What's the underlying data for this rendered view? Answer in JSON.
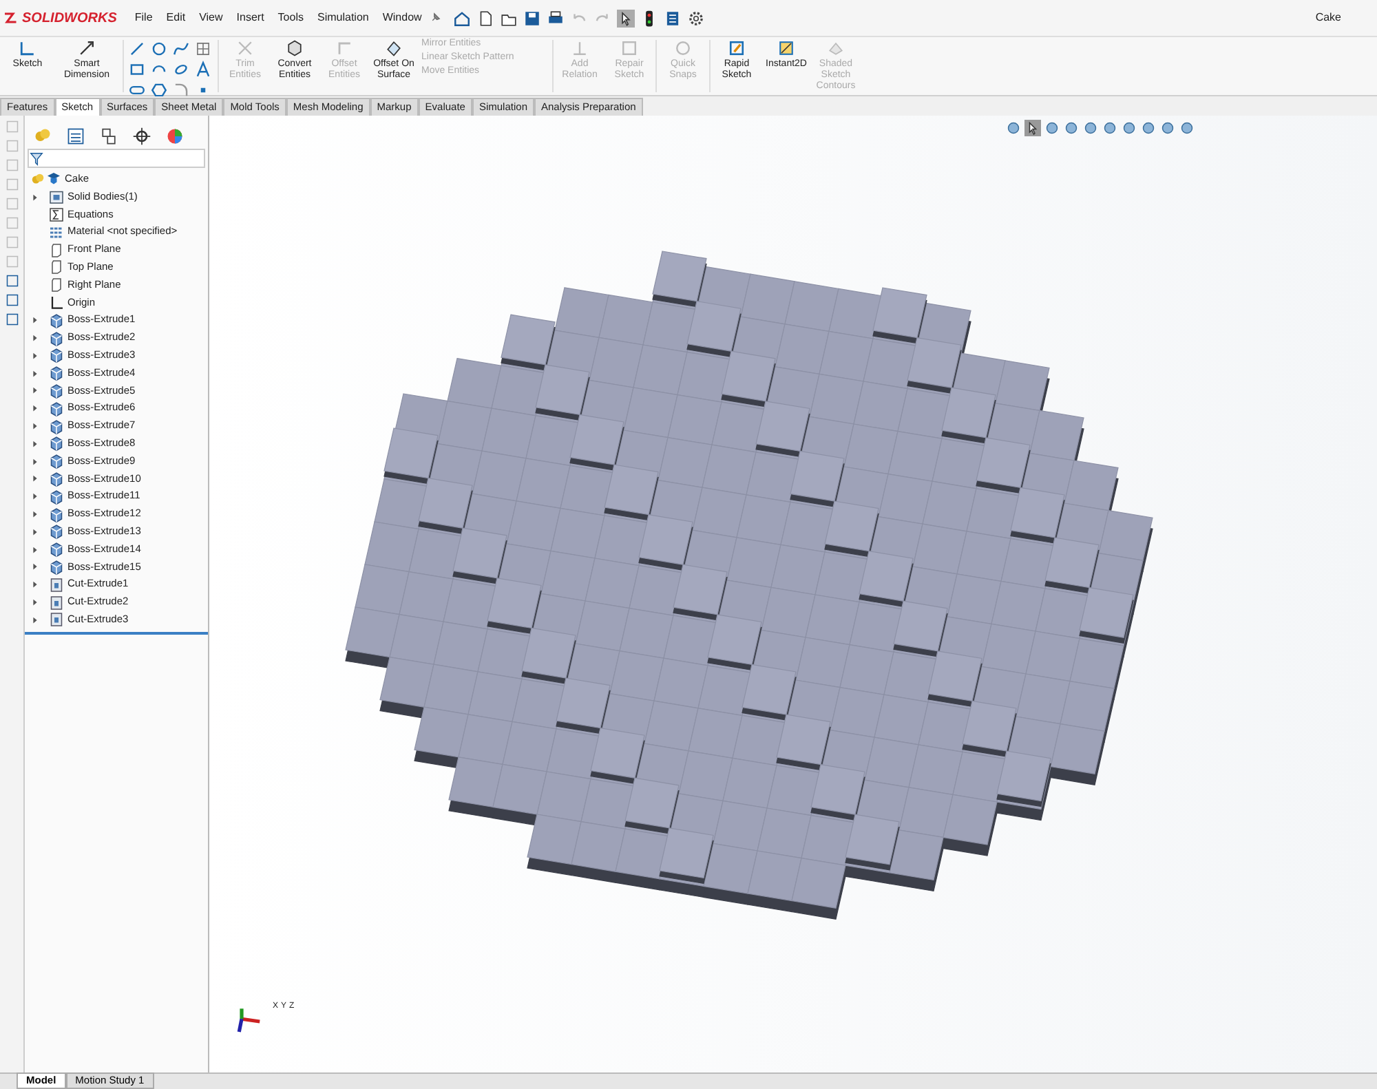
{
  "app": {
    "logo": "SOLIDWORKS",
    "document_title": "Cake"
  },
  "menu": [
    "File",
    "Edit",
    "View",
    "Insert",
    "Tools",
    "Simulation",
    "Window"
  ],
  "ribbon": [
    {
      "kind": "large",
      "label": "Sketch",
      "disabled": false
    },
    {
      "kind": "large",
      "label": "Smart Dimension",
      "disabled": false
    },
    {
      "kind": "tools"
    },
    {
      "kind": "large",
      "label": "Trim Entities",
      "disabled": true
    },
    {
      "kind": "large",
      "label": "Convert Entities",
      "disabled": false
    },
    {
      "kind": "large",
      "label": "Offset Entities",
      "disabled": true
    },
    {
      "kind": "large",
      "label": "Offset On Surface",
      "disabled": false
    },
    {
      "kind": "stack",
      "items": [
        {
          "label": "Mirror Entities",
          "disabled": true
        },
        {
          "label": "Linear Sketch Pattern",
          "disabled": true
        },
        {
          "label": "Move Entities",
          "disabled": true
        }
      ]
    },
    {
      "kind": "large",
      "label": "Add Relation",
      "disabled": true
    },
    {
      "kind": "large",
      "label": "Repair Sketch",
      "disabled": true
    },
    {
      "kind": "large",
      "label": "Quick Snaps",
      "disabled": true
    },
    {
      "kind": "large",
      "label": "Rapid Sketch",
      "disabled": false
    },
    {
      "kind": "large",
      "label": "Instant2D",
      "disabled": false
    },
    {
      "kind": "large",
      "label": "Shaded Sketch Contours",
      "disabled": true
    }
  ],
  "tabs": [
    {
      "label": "Features",
      "selected": false
    },
    {
      "label": "Sketch",
      "selected": true
    },
    {
      "label": "Surfaces",
      "selected": false
    },
    {
      "label": "Sheet Metal",
      "selected": false
    },
    {
      "label": "Mold Tools",
      "selected": false
    },
    {
      "label": "Mesh Modeling",
      "selected": false
    },
    {
      "label": "Markup",
      "selected": false
    },
    {
      "label": "Evaluate",
      "selected": false
    },
    {
      "label": "Simulation",
      "selected": false
    },
    {
      "label": "Analysis Preparation",
      "selected": false
    }
  ],
  "feature_tree": {
    "root": "Cake",
    "items": [
      {
        "label": "Solid Bodies(1)",
        "kind": "folder",
        "expandable": true
      },
      {
        "label": "Equations",
        "kind": "equations",
        "expandable": false
      },
      {
        "label": "Material <not specified>",
        "kind": "material",
        "expandable": false
      },
      {
        "label": "Front Plane",
        "kind": "plane",
        "expandable": false
      },
      {
        "label": "Top Plane",
        "kind": "plane",
        "expandable": false
      },
      {
        "label": "Right Plane",
        "kind": "plane",
        "expandable": false
      },
      {
        "label": "Origin",
        "kind": "origin",
        "expandable": false
      },
      {
        "label": "Boss-Extrude1",
        "kind": "boss",
        "expandable": true
      },
      {
        "label": "Boss-Extrude2",
        "kind": "boss",
        "expandable": true
      },
      {
        "label": "Boss-Extrude3",
        "kind": "boss",
        "expandable": true
      },
      {
        "label": "Boss-Extrude4",
        "kind": "boss",
        "expandable": true
      },
      {
        "label": "Boss-Extrude5",
        "kind": "boss",
        "expandable": true
      },
      {
        "label": "Boss-Extrude6",
        "kind": "boss",
        "expandable": true
      },
      {
        "label": "Boss-Extrude7",
        "kind": "boss",
        "expandable": true
      },
      {
        "label": "Boss-Extrude8",
        "kind": "boss",
        "expandable": true
      },
      {
        "label": "Boss-Extrude9",
        "kind": "boss",
        "expandable": true
      },
      {
        "label": "Boss-Extrude10",
        "kind": "boss",
        "expandable": true
      },
      {
        "label": "Boss-Extrude11",
        "kind": "boss",
        "expandable": true
      },
      {
        "label": "Boss-Extrude12",
        "kind": "boss",
        "expandable": true
      },
      {
        "label": "Boss-Extrude13",
        "kind": "boss",
        "expandable": true
      },
      {
        "label": "Boss-Extrude14",
        "kind": "boss",
        "expandable": true
      },
      {
        "label": "Boss-Extrude15",
        "kind": "boss",
        "expandable": true
      },
      {
        "label": "Cut-Extrude1",
        "kind": "cut",
        "expandable": true
      },
      {
        "label": "Cut-Extrude2",
        "kind": "cut",
        "expandable": true
      },
      {
        "label": "Cut-Extrude3",
        "kind": "cut",
        "expandable": true
      }
    ]
  },
  "triad": {
    "x": "X",
    "y": "Y",
    "z": "Z"
  },
  "bottom_tabs": [
    {
      "label": "Model",
      "selected": true
    },
    {
      "label": "Motion Study 1",
      "selected": false
    }
  ]
}
